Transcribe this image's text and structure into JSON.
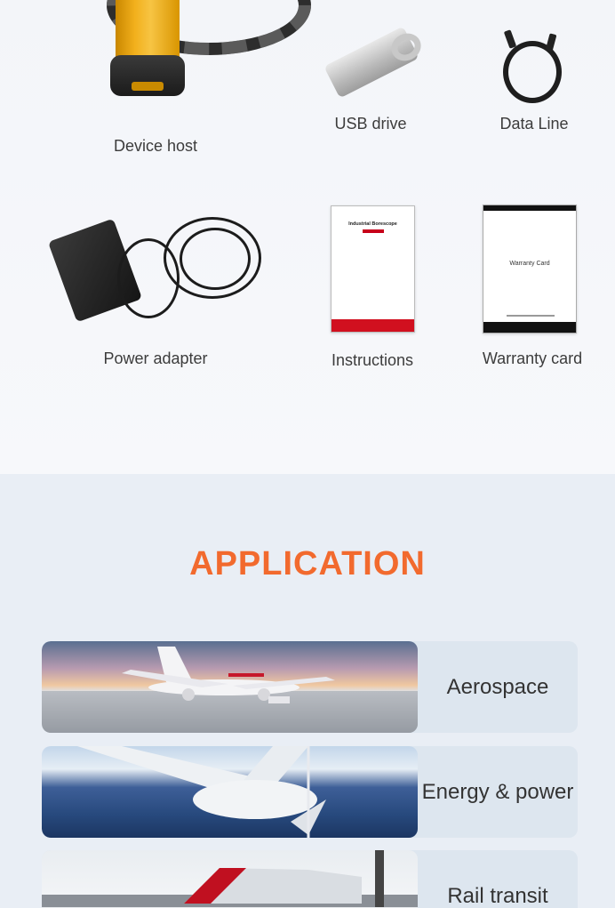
{
  "package_contents": {
    "items": [
      {
        "label": "Device host",
        "icon": "borescope-device-icon"
      },
      {
        "label": "USB drive",
        "icon": "usb-drive-icon"
      },
      {
        "label": "Data Line",
        "icon": "usb-cable-icon"
      },
      {
        "label": "Power adapter",
        "icon": "power-adapter-icon"
      },
      {
        "label": "Instructions",
        "icon": "manual-booklet-icon"
      },
      {
        "label": "Warranty card",
        "icon": "warranty-card-icon"
      }
    ],
    "booklet_cover_title": "Industrial Borescope",
    "warranty_cover_title": "Warranty Card"
  },
  "application": {
    "title": "APPLICATION",
    "cards": [
      {
        "label": "Aerospace",
        "image": "airplane-photo"
      },
      {
        "label": "Energy & power",
        "image": "wind-solar-photo"
      },
      {
        "label": "Rail transit",
        "image": "high-speed-train-photo"
      }
    ]
  },
  "colors": {
    "accent": "#f26a2e",
    "card_background": "#dde6ef",
    "section_background": "#e9eef5"
  }
}
